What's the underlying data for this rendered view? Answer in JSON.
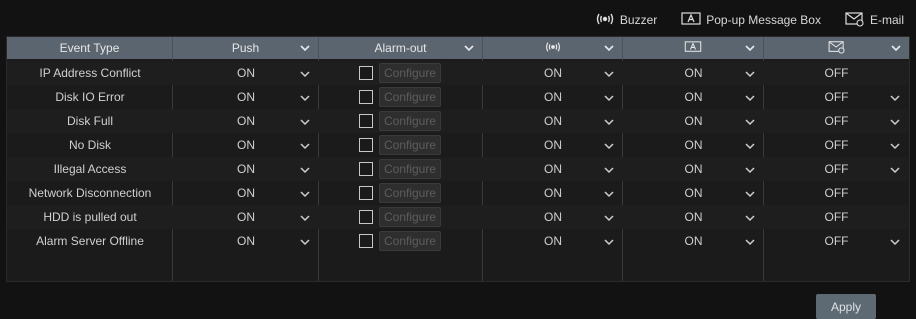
{
  "legend": {
    "buzzer": "Buzzer",
    "popup": "Pop-up Message Box",
    "email": "E-mail"
  },
  "columns": {
    "event_type": "Event Type",
    "push": "Push",
    "alarm_out": "Alarm-out",
    "buzzer_icon": "buzzer-icon",
    "popup_icon": "popup-icon",
    "email_icon": "email-icon"
  },
  "rows": [
    {
      "event": "IP Address Conflict",
      "push": "ON",
      "configure": "Configure",
      "buzzer": "ON",
      "popup": "ON",
      "email": "OFF"
    },
    {
      "event": "Disk IO Error",
      "push": "ON",
      "configure": "Configure",
      "buzzer": "ON",
      "popup": "ON",
      "email": "OFF"
    },
    {
      "event": "Disk Full",
      "push": "ON",
      "configure": "Configure",
      "buzzer": "ON",
      "popup": "ON",
      "email": "OFF"
    },
    {
      "event": "No Disk",
      "push": "ON",
      "configure": "Configure",
      "buzzer": "ON",
      "popup": "ON",
      "email": "OFF"
    },
    {
      "event": "Illegal Access",
      "push": "ON",
      "configure": "Configure",
      "buzzer": "ON",
      "popup": "ON",
      "email": "OFF"
    },
    {
      "event": "Network Disconnection",
      "push": "ON",
      "configure": "Configure",
      "buzzer": "ON",
      "popup": "ON",
      "email": "OFF"
    },
    {
      "event": "HDD is pulled out",
      "push": "ON",
      "configure": "Configure",
      "buzzer": "ON",
      "popup": "ON",
      "email": "OFF"
    },
    {
      "event": "Alarm Server Offline",
      "push": "ON",
      "configure": "Configure",
      "buzzer": "ON",
      "popup": "ON",
      "email": "OFF"
    }
  ],
  "apply": "Apply"
}
